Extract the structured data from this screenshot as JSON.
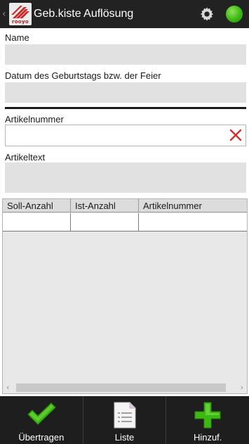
{
  "header": {
    "title": "Geb.kiste Auflösung",
    "logo_text": "rooyo",
    "status_color": "#3cb813"
  },
  "form": {
    "name_label": "Name",
    "name_value": "",
    "date_label": "Datum des Geburtstags bzw. der Feier",
    "date_value": "",
    "article_number_label": "Artikelnummer",
    "article_number_value": "",
    "article_text_label": "Artikeltext",
    "article_text_value": ""
  },
  "table": {
    "columns": [
      "Soll-Anzahl",
      "Ist-Anzahl",
      "Artikelnummer"
    ],
    "rows": [
      [
        "",
        "",
        ""
      ]
    ]
  },
  "bottom_bar": {
    "transfer_label": "Übertragen",
    "list_label": "Liste",
    "add_label": "Hinzuf."
  },
  "icons": {
    "back": "chevron-left-icon",
    "settings": "gear-icon",
    "status": "status-dot-icon",
    "clear": "clear-x-icon",
    "transfer": "checkmark-icon",
    "list": "document-list-icon",
    "add": "plus-icon"
  },
  "colors": {
    "accent_green": "#3cb813",
    "clear_red": "#d32f2f",
    "brand_red": "#b01e1e"
  }
}
